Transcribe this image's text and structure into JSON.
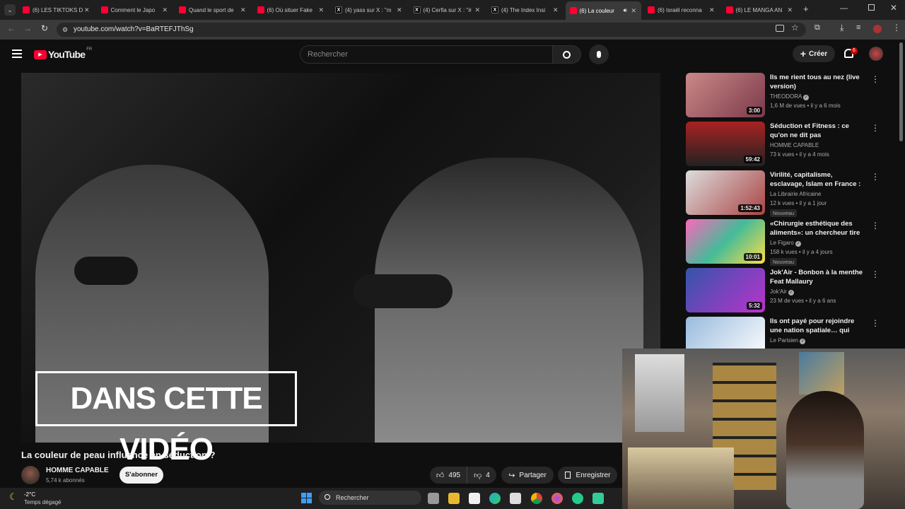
{
  "tabs": [
    {
      "label": "(6) LES TIKTOKS D",
      "icon": "youtube"
    },
    {
      "label": "Comment le Japo",
      "icon": "youtube"
    },
    {
      "label": "Quand le sport de",
      "icon": "youtube"
    },
    {
      "label": "(6) Où situer Fake",
      "icon": "youtube"
    },
    {
      "label": "(4) yass sur X : \"m",
      "icon": "x"
    },
    {
      "label": "(4) Cerfia sur X : \"#",
      "icon": "x"
    },
    {
      "label": "(4) The Index Insi",
      "icon": "x"
    },
    {
      "label": "(6) La couleur",
      "icon": "youtube"
    },
    {
      "label": "(6) Israël reconna",
      "icon": "youtube"
    },
    {
      "label": "(6) LE MANGA AN",
      "icon": "youtube"
    }
  ],
  "address": "youtube.com/watch?v=BaRTEFJThSg",
  "header": {
    "logo": "YouTube",
    "region": "FR",
    "search_placeholder": "Rechercher",
    "create_label": "Créer",
    "notif_count": "6"
  },
  "video": {
    "overlay_text": "DANS CETTE VIDÉO",
    "title": "La couleur de peau influence en séduction ?"
  },
  "channel": {
    "name": "HOMME CAPABLE",
    "subs": "5,74 k abonnés",
    "subscribe_label": "S'abonner"
  },
  "actions": {
    "likes": "495",
    "dislikes": "4",
    "share": "Partager",
    "save": "Enregistrer"
  },
  "recommendations": [
    {
      "title": "Ils me rient tous au nez (live version)",
      "channel": "THEODORA",
      "views": "1,6 M de vues • il y a 6 mois",
      "duration": "3:00",
      "verified": true,
      "badge": ""
    },
    {
      "title": "Séduction et Fitness : ce qu'on ne dit pas",
      "channel": "HOMME CAPABLE",
      "views": "73 k vues • il y a 4 mois",
      "duration": "59:42",
      "verified": false,
      "badge": ""
    },
    {
      "title": "Virilité, capitalisme, esclavage, Islam en France : l'imam Mehd…",
      "channel": "La Librairie Africaine",
      "views": "12 k vues • il y a 1 jour",
      "duration": "1:52:43",
      "verified": false,
      "badge": "Nouveau"
    },
    {
      "title": "«Chirurgie esthétique des aliments»: un chercheur tire la …",
      "channel": "Le Figaro",
      "views": "158 k vues • il y a 4 jours",
      "duration": "10:01",
      "verified": true,
      "badge": "Nouveau"
    },
    {
      "title": "Jok'Air - Bonbon à la menthe Feat Mallaury",
      "channel": "Jok'Air",
      "views": "23 M de vues • il y a 6 ans",
      "duration": "5:32",
      "verified": true,
      "badge": ""
    },
    {
      "title": "Ils ont payé pour rejoindre une nation spatiale… qui n'existe pas",
      "channel": "Le Parisien",
      "views": "",
      "duration": "",
      "verified": true,
      "badge": ""
    }
  ],
  "taskbar": {
    "temp": "-2°C",
    "weather": "Temps dégagé",
    "search": "Rechercher"
  }
}
